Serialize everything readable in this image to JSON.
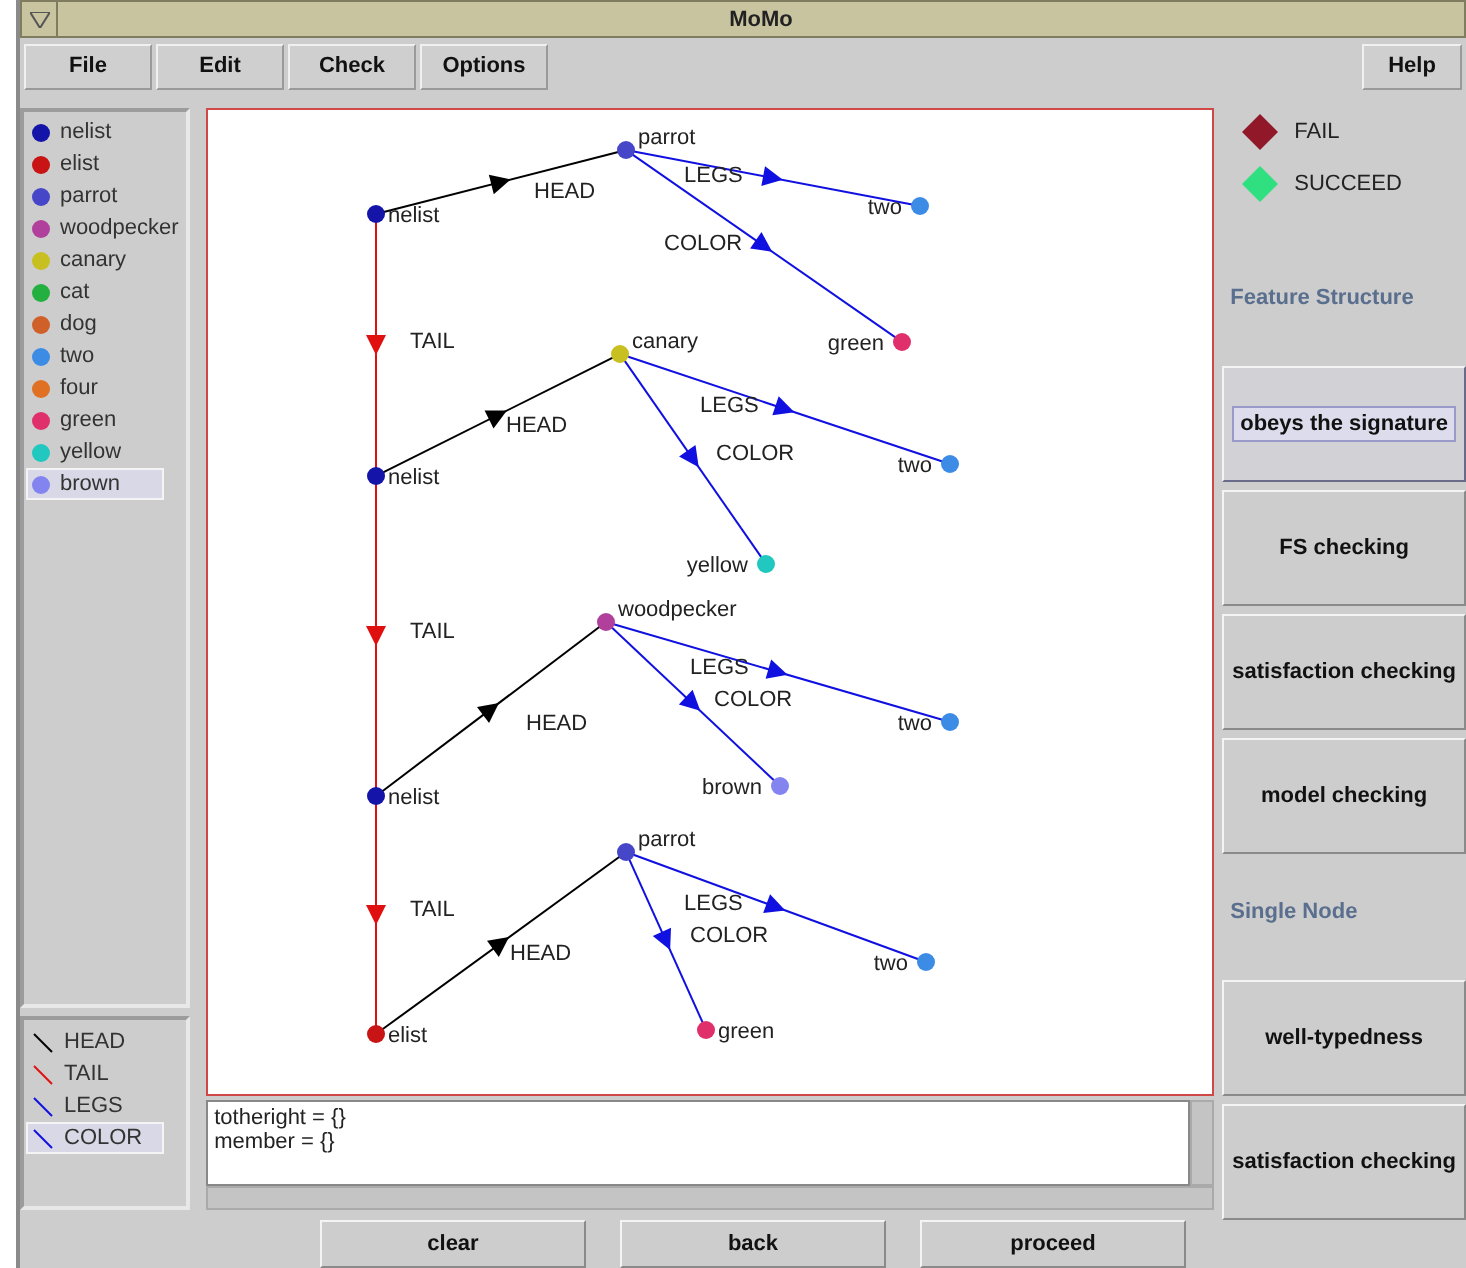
{
  "window": {
    "title": "MoMo"
  },
  "menu": [
    {
      "label": "File"
    },
    {
      "label": "Edit"
    },
    {
      "label": "Check"
    },
    {
      "label": "Options"
    }
  ],
  "help_menu": {
    "label": "Help"
  },
  "type_list": [
    {
      "label": "nelist",
      "color": "#1414a8",
      "selected": false
    },
    {
      "label": "elist",
      "color": "#c81414",
      "selected": false
    },
    {
      "label": "parrot",
      "color": "#4646c8",
      "selected": false
    },
    {
      "label": "woodpecker",
      "color": "#b0409c",
      "selected": false
    },
    {
      "label": "canary",
      "color": "#c8c020",
      "selected": false
    },
    {
      "label": "cat",
      "color": "#24b040",
      "selected": false
    },
    {
      "label": "dog",
      "color": "#d0602a",
      "selected": false
    },
    {
      "label": "two",
      "color": "#3c8ce6",
      "selected": false
    },
    {
      "label": "four",
      "color": "#e07024",
      "selected": false
    },
    {
      "label": "green",
      "color": "#e0306c",
      "selected": false
    },
    {
      "label": "yellow",
      "color": "#20c8c0",
      "selected": false
    },
    {
      "label": "brown",
      "color": "#8484f0",
      "selected": true
    }
  ],
  "feature_list": [
    {
      "label": "HEAD",
      "kind": "head",
      "selected": false
    },
    {
      "label": "TAIL",
      "kind": "tail",
      "selected": false
    },
    {
      "label": "LEGS",
      "kind": "legs",
      "selected": false
    },
    {
      "label": "COLOR",
      "kind": "color",
      "selected": true
    }
  ],
  "graph": {
    "nodes": [
      {
        "label": "nelist",
        "color": "#1414a8"
      },
      {
        "label": "parrot",
        "color": "#4646c8"
      },
      {
        "label": "two",
        "color": "#3c8ce6"
      },
      {
        "label": "green",
        "color": "#e0306c"
      },
      {
        "label": "nelist",
        "color": "#1414a8"
      },
      {
        "label": "canary",
        "color": "#c8c020"
      },
      {
        "label": "two",
        "color": "#3c8ce6"
      },
      {
        "label": "yellow",
        "color": "#20c8c0"
      },
      {
        "label": "nelist",
        "color": "#1414a8"
      },
      {
        "label": "woodpecker",
        "color": "#b0409c"
      },
      {
        "label": "two",
        "color": "#3c8ce6"
      },
      {
        "label": "brown",
        "color": "#8484f0"
      },
      {
        "label": "elist",
        "color": "#c81414"
      },
      {
        "label": "parrot",
        "color": "#4646c8"
      },
      {
        "label": "two",
        "color": "#3c8ce6"
      },
      {
        "label": "green",
        "color": "#e0306c"
      }
    ],
    "edges": [
      {
        "label": "HEAD",
        "kind": "head"
      },
      {
        "label": "LEGS",
        "kind": "legs"
      },
      {
        "label": "COLOR",
        "kind": "color"
      },
      {
        "label": "TAIL",
        "kind": "tail"
      },
      {
        "label": "HEAD",
        "kind": "head"
      },
      {
        "label": "LEGS",
        "kind": "legs"
      },
      {
        "label": "COLOR",
        "kind": "color"
      },
      {
        "label": "TAIL",
        "kind": "tail"
      },
      {
        "label": "HEAD",
        "kind": "head"
      },
      {
        "label": "LEGS",
        "kind": "legs"
      },
      {
        "label": "COLOR",
        "kind": "color"
      },
      {
        "label": "TAIL",
        "kind": "tail"
      },
      {
        "label": "HEAD",
        "kind": "head"
      },
      {
        "label": "LEGS",
        "kind": "legs"
      },
      {
        "label": "COLOR",
        "kind": "color"
      }
    ]
  },
  "output": {
    "lines": [
      "totheright = {}",
      "member = {}"
    ]
  },
  "bottom_buttons": [
    {
      "label": "clear"
    },
    {
      "label": "back"
    },
    {
      "label": "proceed"
    }
  ],
  "result_legend": [
    {
      "label": "FAIL",
      "kind": "fail"
    },
    {
      "label": "SUCCEED",
      "kind": "succeed"
    }
  ],
  "sections": [
    {
      "heading": "Feature Structure",
      "buttons": [
        {
          "label": "obeys the signature",
          "focused": true
        },
        {
          "label": "FS checking",
          "focused": false
        },
        {
          "label": "satisfaction checking",
          "focused": false
        },
        {
          "label": "model checking",
          "focused": false
        }
      ]
    },
    {
      "heading": "Single  Node",
      "buttons": [
        {
          "label": "well-typedness",
          "focused": false
        },
        {
          "label": "satisfaction checking",
          "focused": false
        }
      ]
    }
  ]
}
